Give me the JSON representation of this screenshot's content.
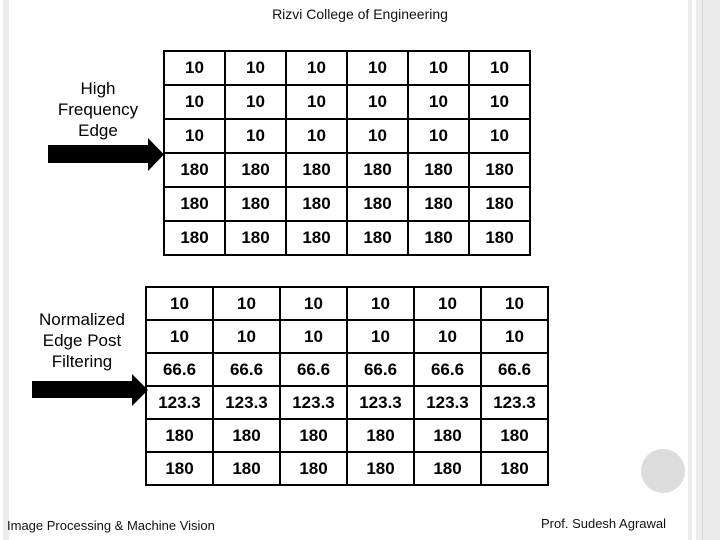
{
  "header": {
    "title": "Rizvi College of Engineering"
  },
  "footer": {
    "left": "Image Processing & Machine Vision",
    "right": "Prof. Sudesh Agrawal"
  },
  "sections": [
    {
      "label_lines": [
        "High",
        "Frequency",
        "Edge"
      ],
      "arrow_icon": "right-arrow-icon",
      "rows": [
        [
          "10",
          "10",
          "10",
          "10",
          "10",
          "10"
        ],
        [
          "10",
          "10",
          "10",
          "10",
          "10",
          "10"
        ],
        [
          "10",
          "10",
          "10",
          "10",
          "10",
          "10"
        ],
        [
          "180",
          "180",
          "180",
          "180",
          "180",
          "180"
        ],
        [
          "180",
          "180",
          "180",
          "180",
          "180",
          "180"
        ],
        [
          "180",
          "180",
          "180",
          "180",
          "180",
          "180"
        ]
      ]
    },
    {
      "label_lines": [
        "Normalized",
        "Edge Post",
        "Filtering"
      ],
      "arrow_icon": "right-arrow-icon",
      "rows": [
        [
          "10",
          "10",
          "10",
          "10",
          "10",
          "10"
        ],
        [
          "10",
          "10",
          "10",
          "10",
          "10",
          "10"
        ],
        [
          "66.6",
          "66.6",
          "66.6",
          "66.6",
          "66.6",
          "66.6"
        ],
        [
          "123.3",
          "123.3",
          "123.3",
          "123.3",
          "123.3",
          "123.3"
        ],
        [
          "180",
          "180",
          "180",
          "180",
          "180",
          "180"
        ],
        [
          "180",
          "180",
          "180",
          "180",
          "180",
          "180"
        ]
      ]
    }
  ],
  "colors": {
    "frame": "#ebebeb",
    "circle": "#dcdcdc",
    "grid_line": "#000000"
  }
}
